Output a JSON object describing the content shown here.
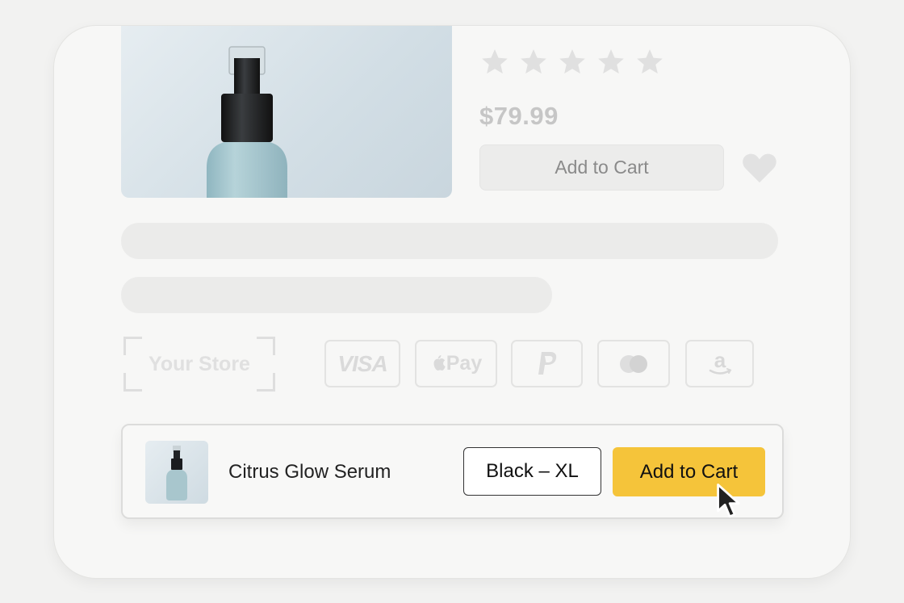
{
  "product": {
    "rating": 5,
    "rating_max": 5,
    "price": "$79.99",
    "add_to_cart_label": "Add to Cart",
    "wishlist_icon": "heart-icon"
  },
  "store": {
    "logo_text": "Your Store"
  },
  "payment_methods": [
    {
      "name": "visa",
      "label": "VISA"
    },
    {
      "name": "apple-pay",
      "label": "Pay"
    },
    {
      "name": "paypal",
      "label": "P"
    },
    {
      "name": "mastercard",
      "label": ""
    },
    {
      "name": "amazon-pay",
      "label": "a"
    }
  ],
  "sticky_bar": {
    "product_name": "Citrus Glow Serum",
    "variant": "Black – XL",
    "cta_label": "Add to Cart"
  },
  "colors": {
    "accent": "#f5c43a",
    "ghost": "#c6c6c6",
    "text": "#222222"
  }
}
